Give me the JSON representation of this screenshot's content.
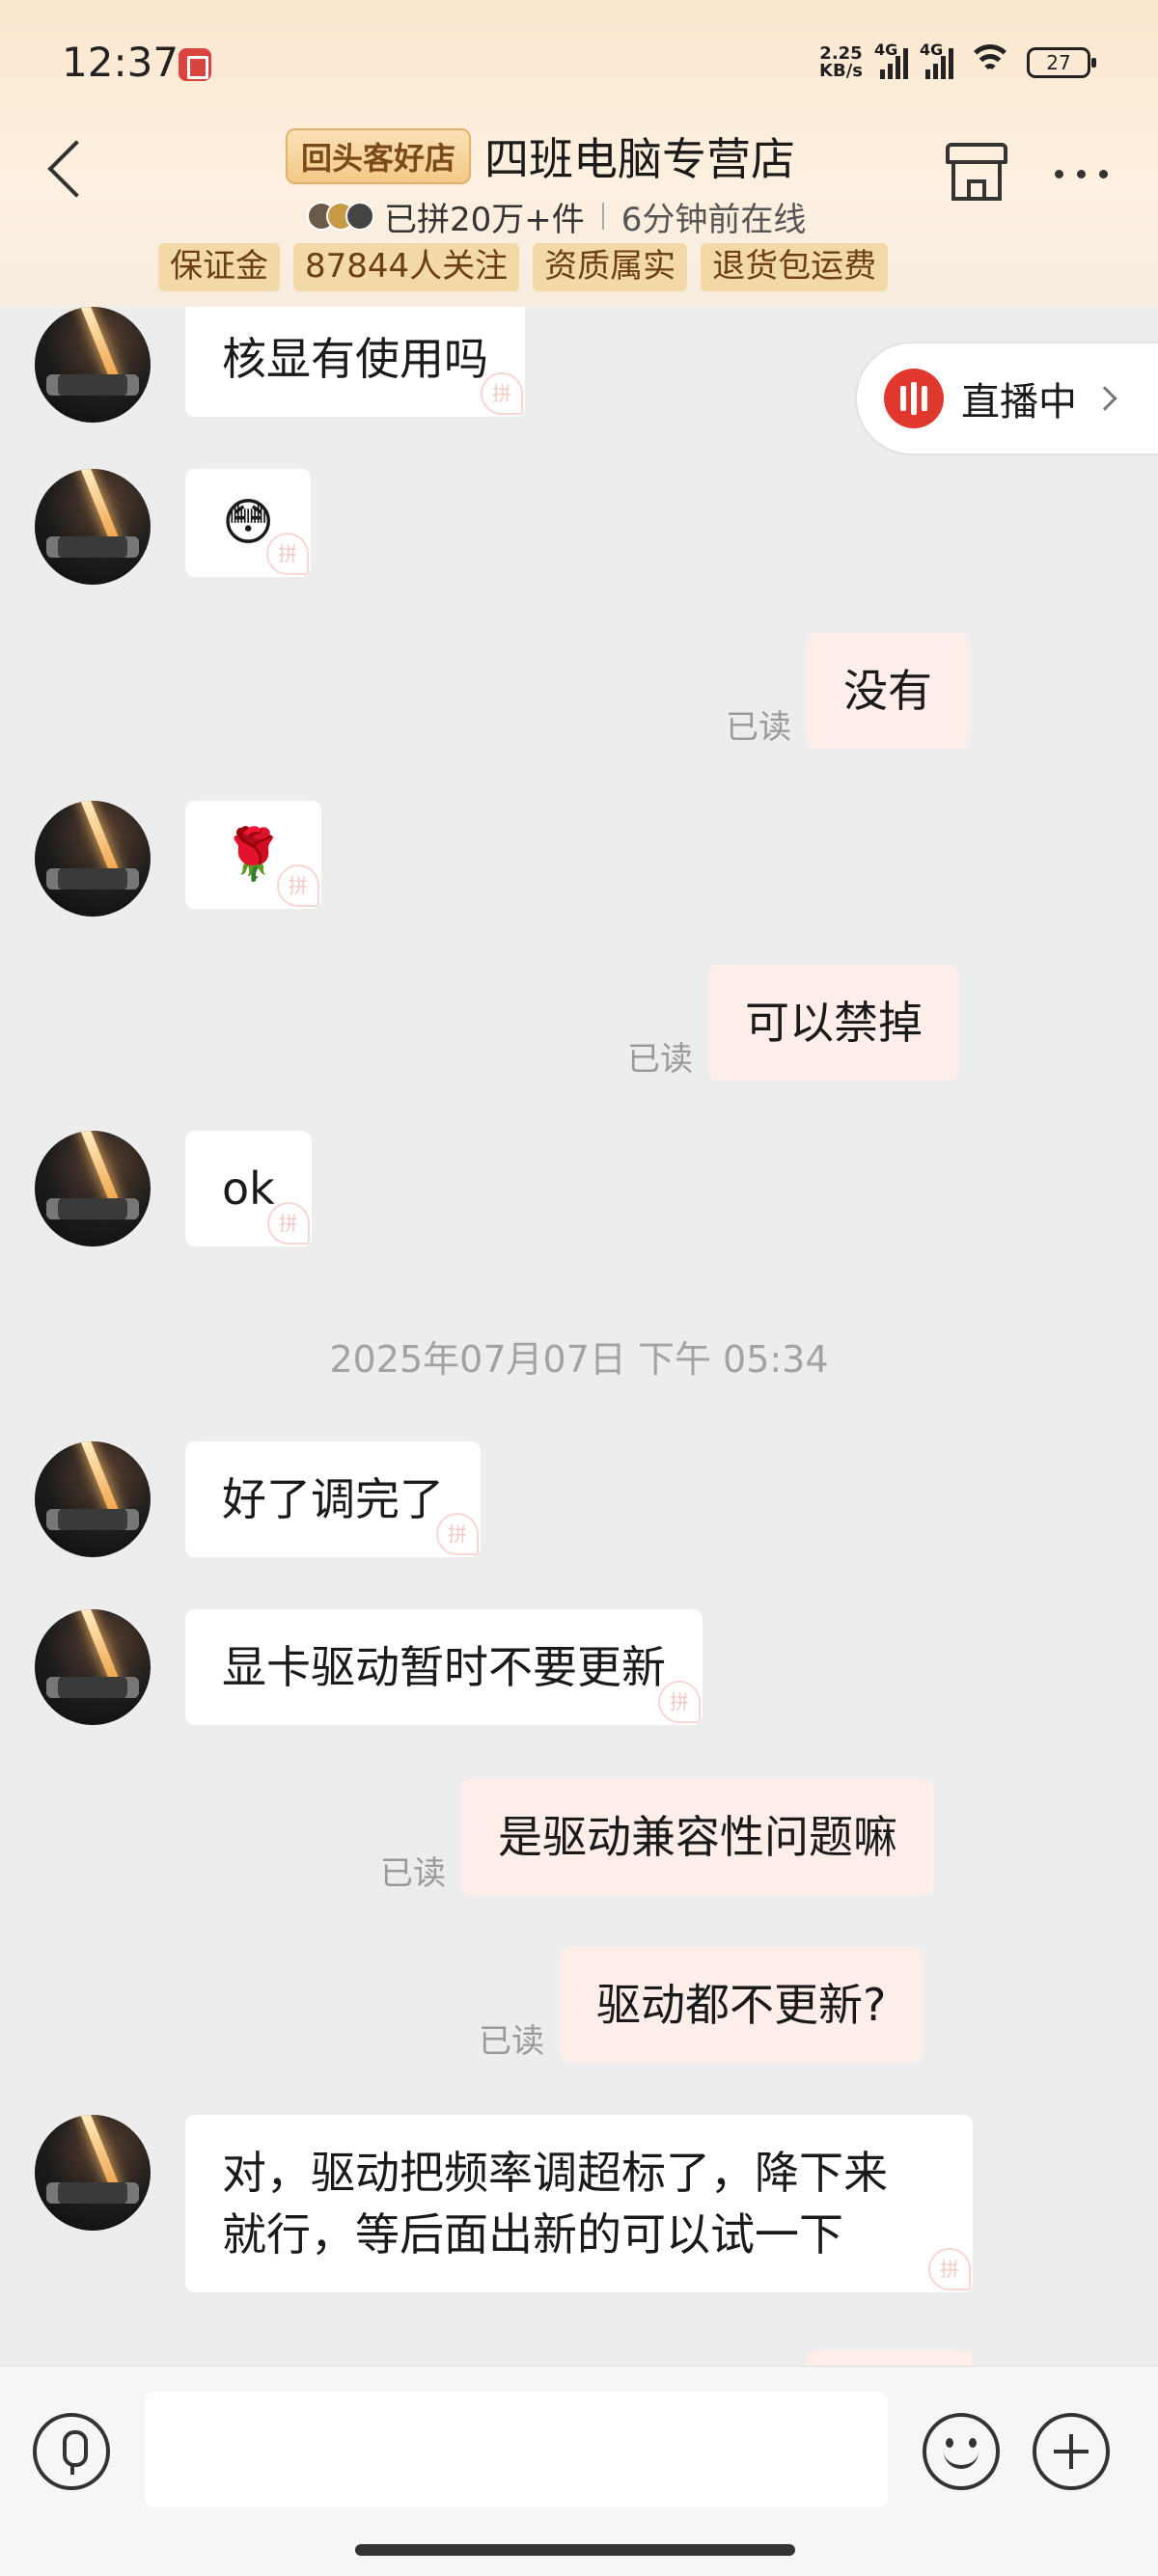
{
  "status_bar": {
    "time": "12:37",
    "net_speed_top": "2.25",
    "net_speed_bottom": "KB/s",
    "signal1_label": "4G",
    "signal2_label": "4G",
    "battery": "27"
  },
  "header": {
    "repeat_badge": "回头客好店",
    "store_name": "四班电脑专营店",
    "sold": "已拼20万+件",
    "online": "6分钟前在线",
    "tags": [
      "保证金",
      "87844人关注",
      "资质属实",
      "退货包运费"
    ]
  },
  "live": {
    "label": "直播中"
  },
  "messages": [
    {
      "dir": "in",
      "text": "核显有使用吗"
    },
    {
      "dir": "in",
      "text": "😳"
    },
    {
      "dir": "out",
      "text": "没有",
      "status": "已读"
    },
    {
      "dir": "in",
      "text": "🌹"
    },
    {
      "dir": "out",
      "text": "可以禁掉",
      "status": "已读"
    },
    {
      "dir": "in",
      "text": "ok"
    },
    {
      "dir": "time",
      "text": "2025年07月07日 下午 05:34"
    },
    {
      "dir": "in",
      "text": "好了调完了"
    },
    {
      "dir": "in",
      "text": "显卡驱动暂时不要更新"
    },
    {
      "dir": "out",
      "text": "是驱动兼容性问题嘛",
      "status": "已读"
    },
    {
      "dir": "out",
      "text": "驱动都不更新?",
      "status": "已读"
    },
    {
      "dir": "in",
      "text_line1": "对，驱动把频率调超标了，降下来",
      "text_line2": "就行，等后面出新的可以试一下"
    }
  ],
  "input": {
    "placeholder": ""
  },
  "colors": {
    "header_gradient_top": "#fbe7cf",
    "chat_bg": "#ededed",
    "outgoing_bubble": "#fdeeea",
    "live_red": "#e0382f",
    "tag_chip": "#f3d8a8"
  },
  "icons": [
    "back-arrow-icon",
    "store-icon",
    "more-icon",
    "live-icon",
    "chevron-right-icon",
    "voice-icon",
    "emoji-icon",
    "plus-icon"
  ]
}
